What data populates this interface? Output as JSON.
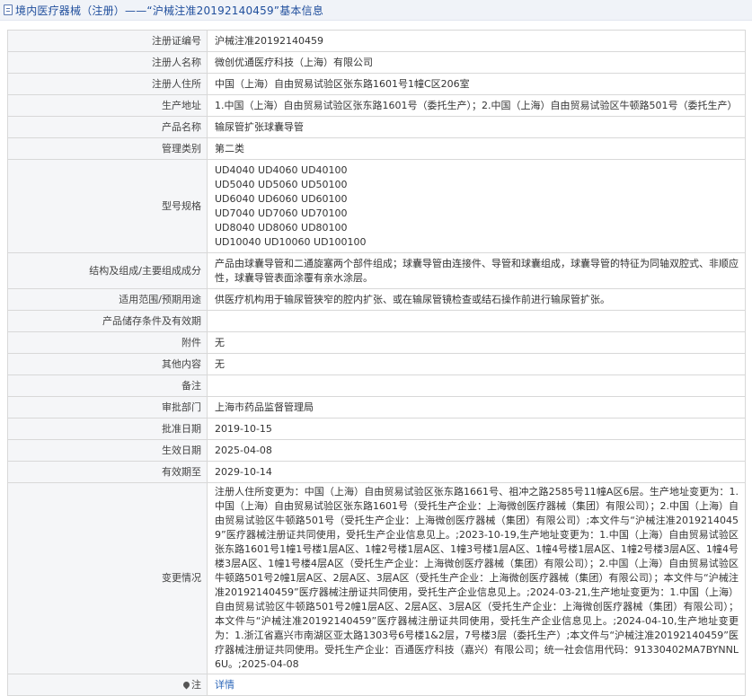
{
  "header": {
    "title": "境内医疗器械（注册）——“沪械注准20192140459”基本信息",
    "icon": "document-icon"
  },
  "rows": [
    {
      "name": "registration-number",
      "label": "注册证编号",
      "value": "沪械注准20192140459",
      "height": 24
    },
    {
      "name": "registrant-name",
      "label": "注册人名称",
      "value": "微创优通医疗科技（上海）有限公司",
      "height": 24
    },
    {
      "name": "registrant-address",
      "label": "注册人住所",
      "value": "中国（上海）自由贸易试验区张东路1601号1幢C区206室",
      "height": 24
    },
    {
      "name": "production-address",
      "label": "生产地址",
      "value": "1.中国（上海）自由贸易试验区张东路1601号（委托生产）；2.中国（上海）自由贸易试验区牛顿路501号（委托生产）",
      "height": 24
    },
    {
      "name": "product-name",
      "label": "产品名称",
      "value": "输尿管扩张球囊导管",
      "height": 24
    },
    {
      "name": "management-category",
      "label": "管理类别",
      "value": "第二类",
      "height": 24
    },
    {
      "name": "models-specs",
      "label": "型号规格",
      "lines": [
        "UD4040 UD4060 UD40100",
        "UD5040 UD5060 UD50100",
        "UD6040 UD6060 UD60100",
        "UD7040 UD7060 UD70100",
        "UD8040 UD8060 UD80100",
        "UD10040 UD10060 UD100100"
      ],
      "height": 104
    },
    {
      "name": "structure-composition",
      "label": "结构及组成/主要组成成分",
      "value": "产品由球囊导管和二通旋塞两个部件组成；球囊导管由连接件、导管和球囊组成，球囊导管的特征为同轴双腔式、非顺应性，球囊导管表面涂覆有亲水涂层。",
      "height": 40
    },
    {
      "name": "intended-use",
      "label": "适用范围/预期用途",
      "value": "供医疗机构用于输尿管狭窄的腔内扩张、或在输尿管镜检查或结石操作前进行输尿管扩张。",
      "height": 24
    },
    {
      "name": "storage-conditions",
      "label": "产品储存条件及有效期",
      "value": "",
      "height": 24
    },
    {
      "name": "attachments",
      "label": "附件",
      "value": "无",
      "height": 24
    },
    {
      "name": "other-content",
      "label": "其他内容",
      "value": "无",
      "height": 24
    },
    {
      "name": "remarks",
      "label": "备注",
      "value": "",
      "height": 24
    },
    {
      "name": "approval-department",
      "label": "审批部门",
      "value": "上海市药品监督管理局",
      "height": 24
    },
    {
      "name": "approval-date",
      "label": "批准日期",
      "value": "2019-10-15",
      "height": 24
    },
    {
      "name": "effective-date",
      "label": "生效日期",
      "value": "2025-04-08",
      "height": 24
    },
    {
      "name": "expiry-date",
      "label": "有效期至",
      "value": "2029-10-14",
      "height": 24
    },
    {
      "name": "change-history",
      "label": "变更情况",
      "value": "注册人住所变更为：中国（上海）自由贸易试验区张东路1661号、祖冲之路2585号11幢A区6层。生产地址变更为：1.中国（上海）自由贸易试验区张东路1601号（受托生产企业：上海微创医疗器械（集团）有限公司）；2.中国（上海）自由贸易试验区牛顿路501号（受托生产企业：上海微创医疗器械（集团）有限公司）;本文件与“沪械注准20192140459”医疗器械注册证共同使用，受托生产企业信息见上。;2023-10-19,生产地址变更为：1.中国（上海）自由贸易试验区张东路1601号1幢1号楼1层A区、1幢2号楼1层A区、1幢3号楼1层A区、1幢4号楼1层A区、1幢2号楼3层A区、1幢4号楼3层A区、1幢1号楼4层A区（受托生产企业：上海微创医疗器械（集团）有限公司）；2.中国（上海）自由贸易试验区牛顿路501号2幢1层A区、2层A区、3层A区（受托生产企业：上海微创医疗器械（集团）有限公司）；本文件与“沪械注准20192140459”医疗器械注册证共同使用，受托生产企业信息见上。;2024-03-21,生产地址变更为：1.中国（上海）自由贸易试验区牛顿路501号2幢1层A区、2层A区、3层A区（受托生产企业：上海微创医疗器械（集团）有限公司）；本文件与“沪械注准20192140459”医疗器械注册证共同使用，受托生产企业信息见上。;2024-04-10,生产地址变更为：1.浙江省嘉兴市南湖区亚太路1303号6号楼1&2层，7号楼3层（委托生产）;本文件与“沪械注准20192140459”医疗器械注册证共同使用。受托生产企业：百通医疗科技（嘉兴）有限公司；统一社会信用代码：91330402MA7BYNNL6U。;2025-04-08",
      "height": 199
    }
  ],
  "footer": {
    "label": "注",
    "pin_icon": "pin-icon",
    "link_text": "详情"
  }
}
